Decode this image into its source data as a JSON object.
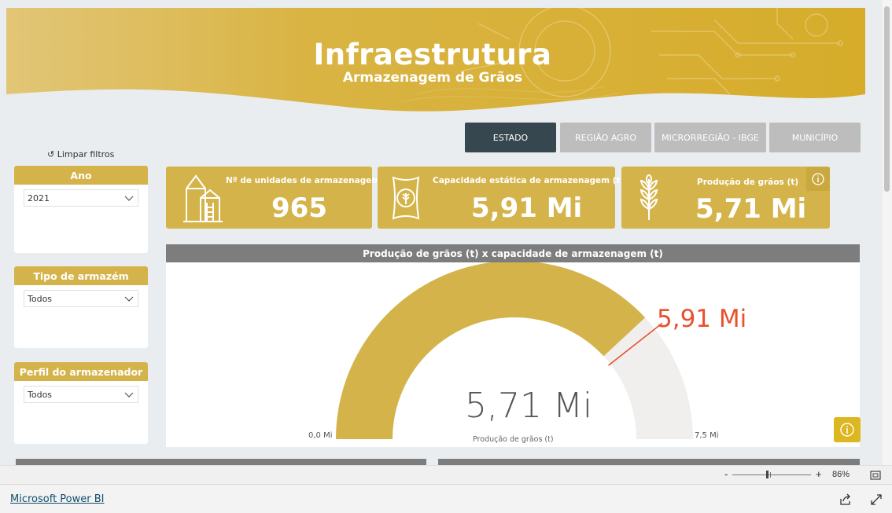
{
  "banner": {
    "title": "Infraestrutura",
    "subtitle": "Armazenagem de Grãos"
  },
  "tabs": [
    {
      "label": "ESTADO",
      "active": true
    },
    {
      "label": "REGIÃO AGRO",
      "active": false
    },
    {
      "label": "MICRORREGIÃO - IBGE",
      "active": false
    },
    {
      "label": "MUNICÍPIO",
      "active": false
    }
  ],
  "clear_filters": "↺ Limpar filtros",
  "slicers": {
    "ano": {
      "title": "Ano",
      "value": "2021"
    },
    "tipo": {
      "title": "Tipo de armazém",
      "value": "Todos"
    },
    "perfil": {
      "title": "Perfil do armazenador",
      "value": "Todos"
    }
  },
  "kpis": {
    "unidades": {
      "label": "Nº de unidades de armazenagem",
      "value": "965",
      "icon": "silo-icon"
    },
    "capacidade": {
      "label": "Capacidade estática de armazenagem (t)",
      "value": "5,91 Mi",
      "icon": "grain-bag-icon"
    },
    "producao": {
      "label": "Produção de grãos (t)",
      "value": "5,71 Mi",
      "icon": "wheat-icon"
    }
  },
  "gauge": {
    "title": "Produção de grãos (t) x capacidade de armazenagem (t)",
    "value": 5.71,
    "value_label": "5,71 Mi",
    "target": 5.91,
    "target_label": "5,91 Mi",
    "min": 0,
    "min_label": "0,0 Mi",
    "max": 7.5,
    "max_label": "7,5 Mi",
    "caption": "Produção de grãos (t)",
    "fill_color": "#d4b44a",
    "track_color": "#f0efee",
    "target_color": "#e8512e"
  },
  "zoom": {
    "minus": "-",
    "plus": "+",
    "level": "86%",
    "slider_fraction": 0.5
  },
  "footer": {
    "link": "Microsoft Power BI"
  }
}
